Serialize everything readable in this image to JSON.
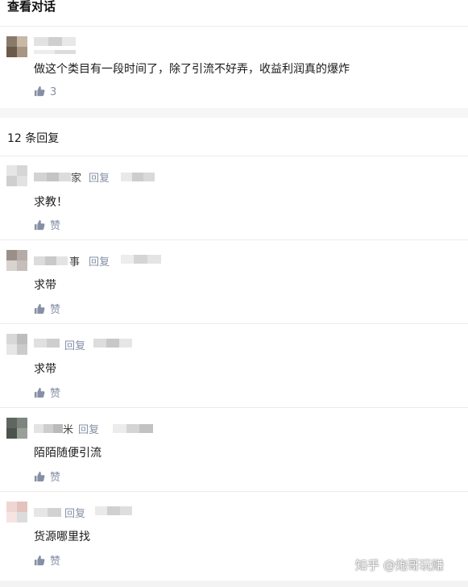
{
  "header": {
    "title": "查看对话"
  },
  "post": {
    "text": "做这个类目有一段时间了，除了引流不好弄，收益利润真的爆炸",
    "likes": "3",
    "like_icon": "thumbs-up-icon"
  },
  "replies_header": {
    "count_text": "12 条回复"
  },
  "replies": [
    {
      "name_suffix": "家",
      "reply_label": "回复",
      "text": "求教！",
      "like_label": "赞"
    },
    {
      "name_suffix": "事",
      "reply_label": "回复",
      "text": "求带",
      "like_label": "赞"
    },
    {
      "name_suffix": "",
      "reply_label": "回复",
      "text": "求带",
      "like_label": "赞"
    },
    {
      "name_suffix": "米",
      "reply_label": "回复",
      "text": "陌陌随便引流",
      "like_label": "赞"
    },
    {
      "name_suffix": "",
      "reply_label": "回复",
      "text": "货源哪里找",
      "like_label": "赞"
    }
  ],
  "watermark": "知乎 @炮哥玩赚",
  "colors": {
    "meta": "#8590a6",
    "divider": "#ebebeb",
    "band": "#f6f6f6"
  }
}
